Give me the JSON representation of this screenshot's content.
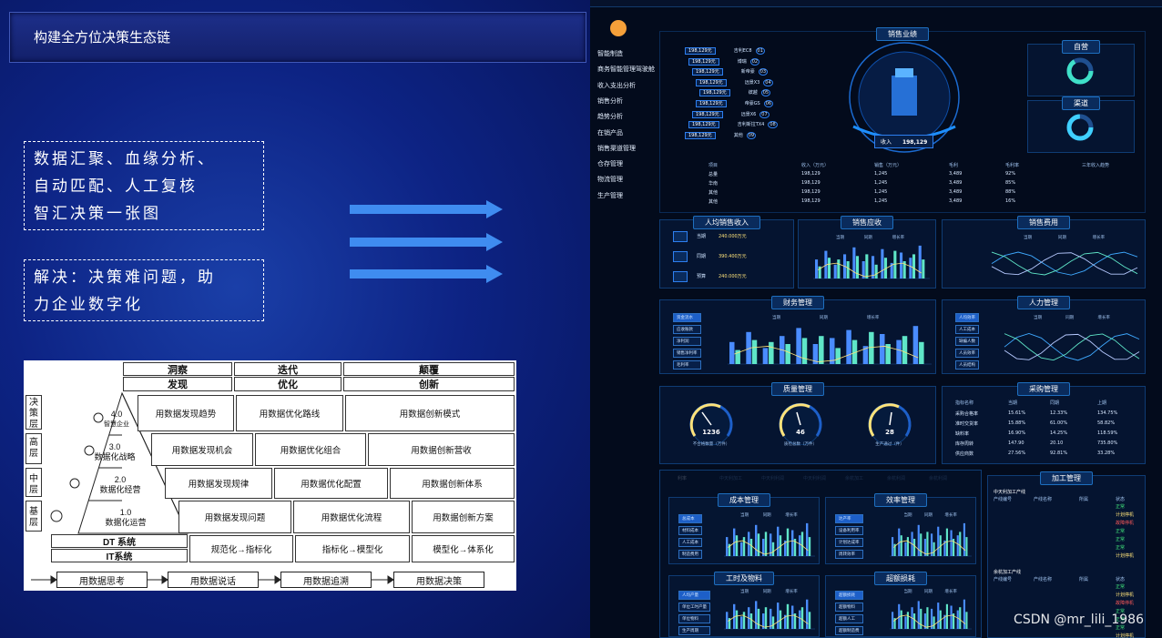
{
  "slide": {
    "title": "构建全方位决策生态链",
    "box1_lines": [
      "数据汇聚、血缘分析、",
      "自动匹配、人工复核",
      "智汇决策一张图"
    ],
    "box2_lines": [
      "解决：决策难问题，助",
      "力企业数字化"
    ],
    "colors": {
      "arrow": "#3f8cf0",
      "bg": "#0d2384"
    }
  },
  "pyramid": {
    "top_headers": [
      "洞察",
      "迭代",
      "颠覆"
    ],
    "sub_headers": [
      "发现",
      "优化",
      "创新"
    ],
    "side_labels": [
      "决策层",
      "高层",
      "中层",
      "基层"
    ],
    "levels": [
      {
        "num": "4.0",
        "name": "智慧企业"
      },
      {
        "num": "3.0",
        "name": "数据化战略"
      },
      {
        "num": "2.0",
        "name": "数据化经营"
      },
      {
        "num": "1.0",
        "name": "数据化运营"
      }
    ],
    "rows": [
      [
        "用数据发现趋势",
        "用数据优化路线",
        "用数据创新模式"
      ],
      [
        "用数据发现机会",
        "用数据优化组合",
        "用数据创新营收"
      ],
      [
        "用数据发现规律",
        "用数据优化配置",
        "用数据创新体系"
      ],
      [
        "用数据发现问题",
        "用数据优化流程",
        "用数据创新方案"
      ]
    ],
    "dt": "DT 系统",
    "it": "IT系统",
    "bottom_row": [
      "规范化→指标化",
      "指标化→模型化",
      "模型化→体系化"
    ],
    "flow": [
      "用数据思考",
      "用数据说话",
      "用数据追溯",
      "用数据决策"
    ]
  },
  "dashboard": {
    "nav": [
      "智能制造",
      "商务智能管理驾驶舱",
      "收入支出分析",
      "销售分析",
      "趋势分析",
      "在销产品",
      "销售渠道管理",
      "仓存管理",
      "物流管理",
      "生产管理"
    ],
    "top_panel_title": "销售业绩",
    "center_label": "收入",
    "center_value": "198,129",
    "sales_items": [
      {
        "value": "198,129元",
        "name": "吉利EC8",
        "idx": "01"
      },
      {
        "value": "198,129元",
        "name": "博瑞",
        "idx": "02"
      },
      {
        "value": "198,129元",
        "name": "新帝豪",
        "idx": "03"
      },
      {
        "value": "198,129元",
        "name": "远景X3",
        "idx": "04"
      },
      {
        "value": "198,129元",
        "name": "缤越",
        "idx": "05"
      },
      {
        "value": "198,129元",
        "name": "帝豪GS",
        "idx": "06"
      },
      {
        "value": "198,129元",
        "name": "远景X6",
        "idx": "07"
      },
      {
        "value": "198,129元",
        "name": "吉利新拉TX4",
        "idx": "08"
      },
      {
        "value": "198,129元",
        "name": "其他",
        "idx": "09"
      }
    ],
    "right_mini": [
      "自营",
      "渠道"
    ],
    "table_headers": [
      "项目",
      "收入（万元）",
      "销售（万元）",
      "毛利",
      "毛利率",
      "三年收入趋势"
    ],
    "table_rows": [
      [
        "总量",
        "198,129",
        "1,245",
        "3,489",
        "92%"
      ],
      [
        "华南",
        "198,129",
        "1,245",
        "3,489",
        "85%"
      ],
      [
        "其他",
        "198,129",
        "1,245",
        "3,489",
        "88%"
      ],
      [
        "其他",
        "198,129",
        "1,245",
        "3,489",
        "16%"
      ]
    ],
    "percap_title": "人均销售收入",
    "percap_rows": [
      {
        "label": "当期",
        "value": "240.000万元"
      },
      {
        "label": "同期",
        "value": "390.400万元"
      },
      {
        "label": "预算",
        "value": "240.000万元"
      }
    ],
    "panel_titles": [
      "销售应收",
      "销售费用",
      "财务管理",
      "人力管理",
      "质量管理",
      "采购管理",
      "成本管理",
      "效率管理",
      "加工管理",
      "工时及物料",
      "超额损耗"
    ],
    "gauges": [
      {
        "value": "1236",
        "label": "不合格数量（万件）"
      },
      {
        "value": "46",
        "label": "质检总数（万件）"
      },
      {
        "value": "28",
        "label": "生产通过（件）"
      }
    ],
    "purchase_headers": [
      "指标名称",
      "当期",
      "同期",
      "上期"
    ],
    "purchase_rows": [
      [
        "采购合格率",
        "15.61%",
        "12.33%",
        "134.75%"
      ],
      [
        "准时交货率",
        "15.88%",
        "61.00%",
        "58.82%"
      ],
      [
        "缺料率",
        "16.90%",
        "14.25%",
        "118.59%"
      ],
      [
        "库存周转",
        "147.90",
        "20.10",
        "735.80%"
      ],
      [
        "供应商数",
        "27.56%",
        "92.81%",
        "33.28%"
      ]
    ],
    "tabs": [
      "利率",
      "中天利加工",
      "中天利利润",
      "中天利利润",
      "余杭加工",
      "余杭利润",
      "余杭利润"
    ],
    "fin_side": [
      "资金流水",
      "应收账款",
      "净利润",
      "销售净利率",
      "毛利率"
    ],
    "hr_side": [
      "人均效率",
      "人工成本",
      "缺编人数",
      "人员效率",
      "人员结构"
    ],
    "cost_side": [
      "总成本",
      "材料成本",
      "人工成本",
      "制造费用"
    ],
    "eff_side": [
      "达产率",
      "设备利用率",
      "计划达成率",
      "周转效率"
    ],
    "labor_side": [
      "人均产量",
      "单位工时产量",
      "单位物料",
      "生产周期"
    ],
    "loss_side": [
      "超额损耗",
      "超额物料",
      "超额人工",
      "超额制造费"
    ],
    "legend": [
      "当期",
      "同期",
      "增长率"
    ],
    "months": [
      "1月",
      "2月",
      "3月",
      "4月",
      "5月",
      "6月",
      "7月",
      "8月",
      "9月",
      "10月",
      "11月",
      "12月"
    ],
    "process_groups": [
      "中天利加工产线",
      "余杭加工产线"
    ],
    "process_headers": [
      "产线编号",
      "产线名称",
      "所属",
      "状态"
    ],
    "process_status": [
      "正常",
      "计划停机",
      "故障停机",
      "正常",
      "正常",
      "正常",
      "计划停机"
    ],
    "colors": {
      "bar1": "#4a8cff",
      "bar2": "#5fe6c8",
      "line": "#ffe37a",
      "panel": "#061634",
      "border": "#0f3c74"
    }
  },
  "watermark": "CSDN @mr_lili_1986"
}
